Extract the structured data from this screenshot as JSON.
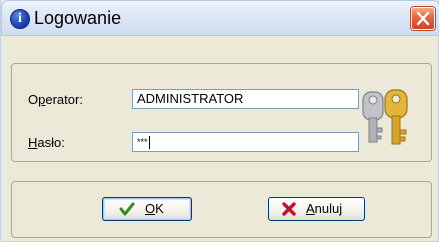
{
  "window": {
    "title": "Logowanie",
    "title_icon": "info-icon",
    "title_icon_glyph": "i",
    "close_icon": "close-icon"
  },
  "form": {
    "operator_label_prefix": "O",
    "operator_label_underlined": "p",
    "operator_label_suffix": "erator:",
    "operator_value": "ADMINISTRATOR",
    "password_label_underlined": "H",
    "password_label_suffix": "asło:",
    "password_value": "***",
    "decoration_icon": "keys-icon"
  },
  "buttons": {
    "ok_label_underlined": "O",
    "ok_label_suffix": "K",
    "ok_icon": "checkmark-icon",
    "cancel_label_underlined": "A",
    "cancel_label_suffix": "nuluj",
    "cancel_icon": "red-x-icon"
  },
  "colors": {
    "ok_check": "#2e8b1e",
    "cancel_x": "#c8102e",
    "close_button": "#e2673f"
  }
}
